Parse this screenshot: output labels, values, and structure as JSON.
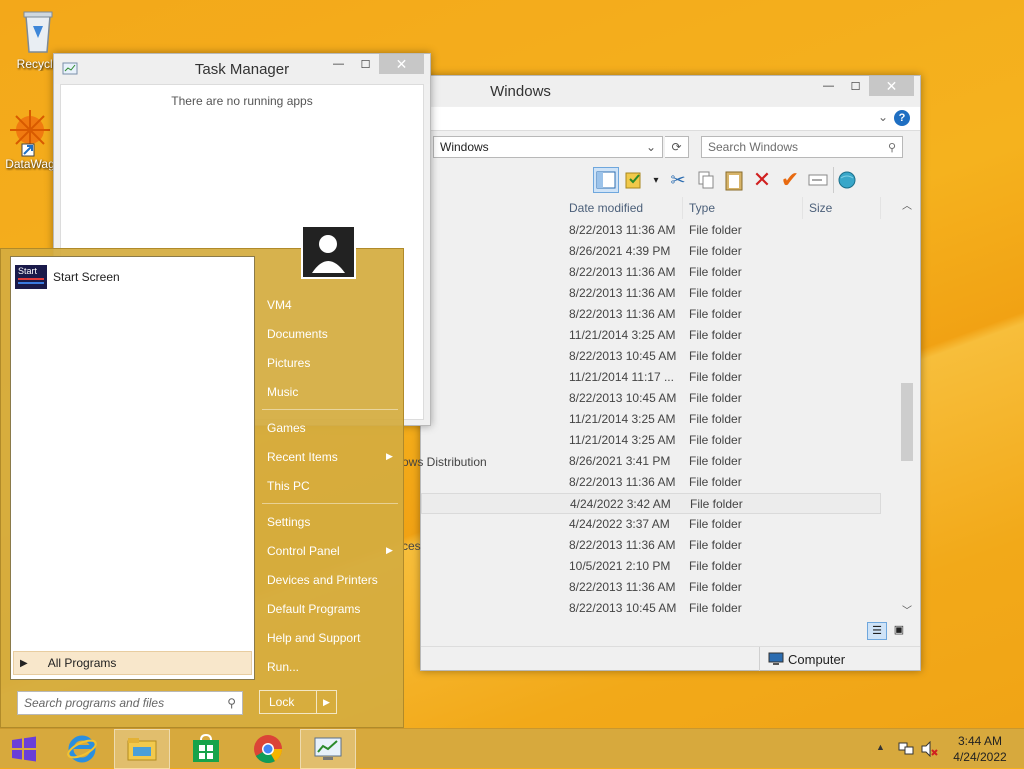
{
  "desktop": {
    "icons": [
      {
        "label": "Recycle",
        "icon": "recycle-bin-icon"
      },
      {
        "label": "DataWag",
        "icon": "datawag-icon"
      }
    ]
  },
  "task_manager": {
    "title": "Task Manager",
    "empty_text": "There are no running apps"
  },
  "explorer": {
    "title": "Windows",
    "address": "Windows",
    "search_placeholder": "Search Windows",
    "columns": [
      "Date modified",
      "Type",
      "Size"
    ],
    "partial_names": [
      "nk",
      "ows Distribution",
      "ces"
    ],
    "rows": [
      {
        "date": "8/22/2013 11:36 AM",
        "type": "File folder"
      },
      {
        "date": "8/26/2021 4:39 PM",
        "type": "File folder"
      },
      {
        "date": "8/22/2013 11:36 AM",
        "type": "File folder"
      },
      {
        "date": "8/22/2013 11:36 AM",
        "type": "File folder"
      },
      {
        "date": "8/22/2013 11:36 AM",
        "type": "File folder"
      },
      {
        "date": "11/21/2014 3:25 AM",
        "type": "File folder"
      },
      {
        "date": "8/22/2013 10:45 AM",
        "type": "File folder"
      },
      {
        "date": "11/21/2014 11:17 ...",
        "type": "File folder"
      },
      {
        "date": "8/22/2013 10:45 AM",
        "type": "File folder"
      },
      {
        "date": "11/21/2014 3:25 AM",
        "type": "File folder"
      },
      {
        "date": "11/21/2014 3:25 AM",
        "type": "File folder"
      },
      {
        "date": "8/26/2021 3:41 PM",
        "type": "File folder"
      },
      {
        "date": "8/22/2013 11:36 AM",
        "type": "File folder"
      },
      {
        "date": "4/24/2022 3:42 AM",
        "type": "File folder"
      },
      {
        "date": "4/24/2022 3:37 AM",
        "type": "File folder"
      },
      {
        "date": "8/22/2013 11:36 AM",
        "type": "File folder"
      },
      {
        "date": "10/5/2021 2:10 PM",
        "type": "File folder"
      },
      {
        "date": "8/22/2013 11:36 AM",
        "type": "File folder"
      },
      {
        "date": "8/22/2013 10:45 AM",
        "type": "File folder"
      }
    ],
    "status_location": "Computer"
  },
  "start_menu": {
    "start_screen_label": "Start Screen",
    "start_tile_text": "Start",
    "all_programs": "All Programs",
    "search_placeholder": "Search programs and files",
    "right_items": {
      "vm4": "VM4",
      "documents": "Documents",
      "pictures": "Pictures",
      "music": "Music",
      "games": "Games",
      "recent_items": "Recent Items",
      "this_pc": "This PC",
      "settings": "Settings",
      "control_panel": "Control Panel",
      "devices_printers": "Devices and Printers",
      "default_programs": "Default Programs",
      "help_support": "Help and Support",
      "run": "Run..."
    },
    "lock": "Lock"
  },
  "taskbar": {
    "time": "3:44 AM",
    "date": "4/24/2022"
  },
  "colors": {
    "desktop": "#f3a81a",
    "start_menu": "#d4ac40",
    "taskbar": "#d7a93d",
    "accent_blue": "#1f6fc2"
  }
}
